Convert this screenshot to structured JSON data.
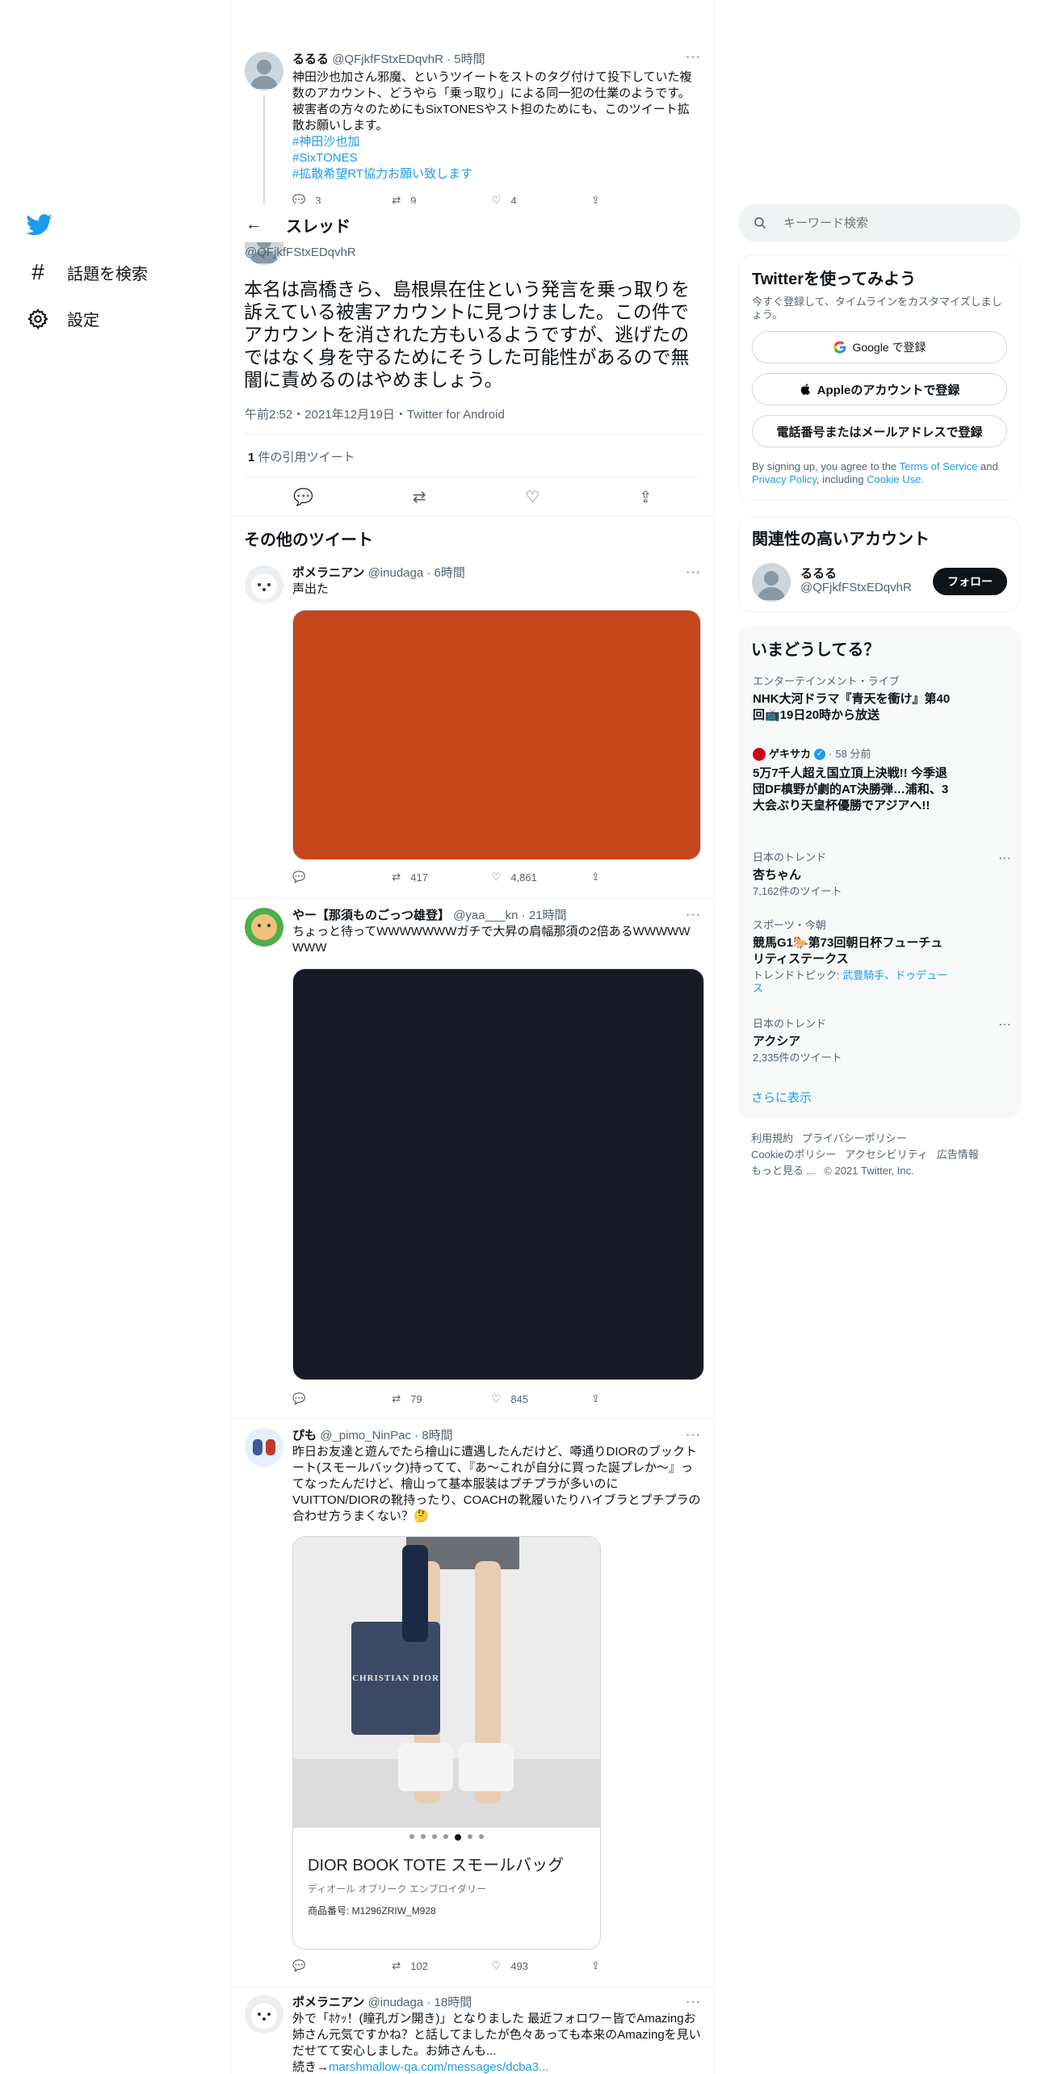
{
  "nav": {
    "explore": "話題を検索",
    "settings": "設定"
  },
  "header": {
    "title": "スレッド"
  },
  "parent": {
    "name": "るるる",
    "handle": "@QFjkfFStxEDqvhR",
    "time": "5時間",
    "text": "神田沙也加さん邪魔、というツイートをストのタグ付けて投下していた複数のアカウント、どうやら「乗っ取り」による同一犯の仕業のようです。被害者の方々のためにもSixTONESやスト担のためにも、このツイート拡散お願いします。",
    "tags": [
      "#神田沙也加",
      "#SixTONES",
      "#拡散希望RT協力お願い致します"
    ],
    "replies": "3",
    "retweets": "9",
    "likes": "4"
  },
  "main": {
    "handle": "@QFjkfFStxEDqvhR",
    "text": "本名は高橋きら、島根県在住という発言を乗っ取りを訴えている被害アカウントに見つけました。この件でアカウントを消された方もいるようですが、逃げたのではなく身を守るためにそうした可能性があるので無闇に責めるのはやめましょう。",
    "meta": "午前2:52・2021年12月19日・Twitter for Android",
    "quote_count": "1",
    "quote_label": " 件の引用ツイート"
  },
  "more_title": "その他のツイート",
  "tweets": [
    {
      "name": "ポメラニアン",
      "handle": "@inudaga",
      "time": "6時間",
      "text": "声出た",
      "retweets": "417",
      "likes": "4,861",
      "media_color": "#c5461b"
    },
    {
      "name": "やー【那須ものごっつ雄登】",
      "handle": "@yaa___kn",
      "time": "21時間",
      "text": "ちょっと待ってWWWWWWWガチで大昇の肩幅那須の2倍あるWWWWWWWW",
      "retweets": "79",
      "likes": "845",
      "media_color": "#171a26"
    },
    {
      "name": "ぴも",
      "handle": "@_pimo_NinPac",
      "time": "8時間",
      "text": "昨日お友達と遊んでたら檜山に遭遇したんだけど、噂通りDIORのブックトート(スモールバック)持ってて、『あ〜これが自分に買った誕プレか〜』ってなったんだけど、檜山って基本服装はプチプラが多いのにVUITTON/DIORの靴持ったり、COACHの靴履いたりハイブラとプチプラの合わせ方うまくない？🤔",
      "retweets": "102",
      "likes": "493",
      "card": {
        "bag_label": "CHRISTIAN DIOR",
        "title": "DIOR BOOK TOTE スモールバッグ",
        "subtitle": "ディオール オブリーク エンブロイダリー",
        "product": "商品番号: M1296ZRIW_M928"
      }
    },
    {
      "name": "ポメラニアン",
      "handle": "@inudaga",
      "time": "18時間",
      "text": "外で「ﾎｹｯ！(瞳孔ガン開き)」となりました 最近フォロワー皆でAmazingお姉さん元気ですかね？と話してましたが色々あっても本来のAmazingを見いだせてて安心しました。お姉さんも...",
      "link_prefix": "続き→",
      "link": "marshmallow-qa.com/messages/dcba3..."
    }
  ],
  "search": {
    "placeholder": "キーワード検索"
  },
  "signup": {
    "title": "Twitterを使ってみよう",
    "subtitle": "今すぐ登録して、タイムラインをカスタマイズしましょう。",
    "google": "Google で登録",
    "apple": "Appleのアカウントで登録",
    "phone": "電話番号またはメールアドレスで登録",
    "legal_1": "By signing up, you agree to the ",
    "terms": "Terms of Service",
    "legal_2": " and ",
    "privacy": "Privacy Policy",
    "legal_3": ", including ",
    "cookie": "Cookie Use",
    "legal_4": "."
  },
  "relevant": {
    "title": "関連性の高いアカウント",
    "name": "るるる",
    "handle": "@QFjkfFStxEDqvhR",
    "follow": "フォロー"
  },
  "trends": {
    "title": "いまどうしてる？",
    "items": [
      {
        "context": "エンターテインメント・ライブ",
        "title": "NHK大河ドラマ『青天を衝け』第40回📺19日20時から放送"
      },
      {
        "source": "ゲキサカ",
        "time": "58 分前",
        "title": "5万7千人超え国立頂上決戦!! 今季退団DF槙野が劇的AT決勝弾…浦和、3大会ぶり天皇杯優勝でアジアへ!!"
      },
      {
        "context": "日本のトレンド",
        "title": "杏ちゃん",
        "count": "7,162件のツイート"
      },
      {
        "context": "スポーツ・今朝",
        "title": "競馬G1🐎第73回朝日杯フューチュリティステークス",
        "topic_label": "トレンドトピック: ",
        "topic": "武豊騎手、ドゥデュース"
      },
      {
        "context": "日本のトレンド",
        "title": "アクシア",
        "count": "2,335件のツイート"
      }
    ],
    "show_more": "さらに表示"
  },
  "footer": {
    "terms": "利用規約",
    "privacy": "プライバシーポリシー",
    "cookie": "Cookieのポリシー",
    "accessibility": "アクセシビリティ",
    "ads": "広告情報",
    "more": "もっと見る ...",
    "copyright": "© 2021 Twitter, Inc."
  },
  "colors": {
    "brand": "#1d9bf0",
    "text": "#0f1419",
    "secondary": "#536471"
  }
}
